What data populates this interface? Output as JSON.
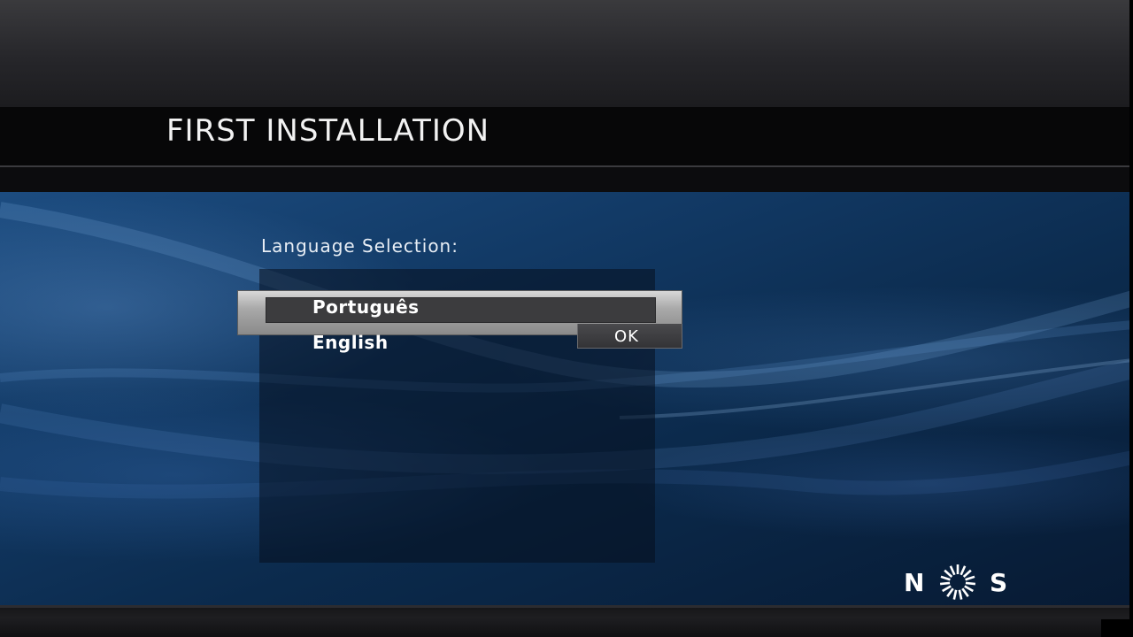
{
  "header": {
    "title": "FIRST INSTALLATION"
  },
  "main": {
    "section_label": "Language Selection:",
    "languages": [
      {
        "label": "Português",
        "selected": true
      },
      {
        "label": "English",
        "selected": false
      }
    ],
    "ok_label": "OK"
  },
  "brand": {
    "logo_text": "NOS"
  },
  "colors": {
    "background_blue": "#123a66",
    "focus_bar": "#a9a9a9",
    "text": "#ffffff"
  }
}
